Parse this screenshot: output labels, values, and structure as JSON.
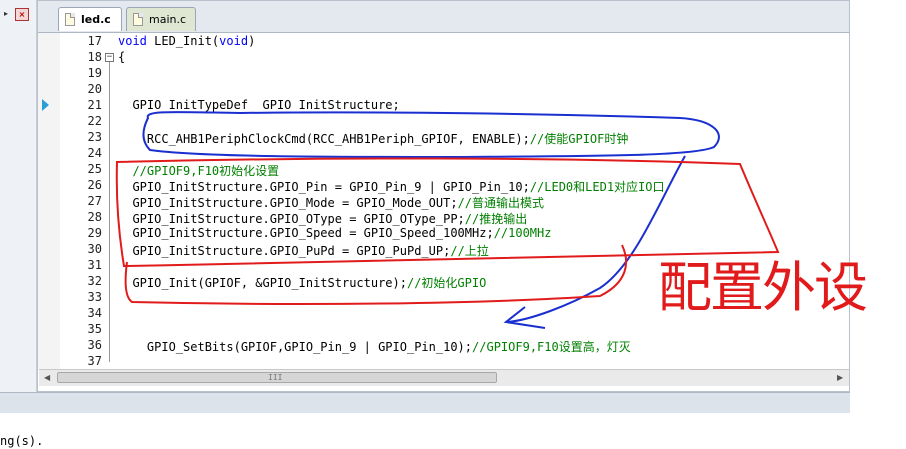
{
  "tabs": [
    {
      "label": "led.c",
      "active": true
    },
    {
      "label": "main.c",
      "active": false
    }
  ],
  "lines": [
    {
      "num": "17",
      "parts": [
        {
          "t": "void",
          "c": "kw"
        },
        {
          "t": " LED_Init(",
          "c": ""
        },
        {
          "t": "void",
          "c": "kw"
        },
        {
          "t": ")",
          "c": ""
        }
      ]
    },
    {
      "num": "18",
      "parts": [
        {
          "t": "{",
          "c": ""
        }
      ]
    },
    {
      "num": "19",
      "parts": []
    },
    {
      "num": "20",
      "parts": []
    },
    {
      "num": "21",
      "parts": [
        {
          "t": "  GPIO_InitTypeDef  GPIO_InitStructure;",
          "c": ""
        }
      ]
    },
    {
      "num": "22",
      "parts": []
    },
    {
      "num": "23",
      "parts": [
        {
          "t": "    RCC_AHB1PeriphClockCmd(RCC_AHB1Periph_GPIOF, ENABLE);",
          "c": ""
        },
        {
          "t": "//使能GPIOF时钟",
          "c": "cm"
        }
      ]
    },
    {
      "num": "24",
      "parts": []
    },
    {
      "num": "25",
      "parts": [
        {
          "t": "  //GPIOF9,F10初始化设置",
          "c": "cm"
        }
      ]
    },
    {
      "num": "26",
      "parts": [
        {
          "t": "  GPIO_InitStructure.GPIO_Pin = GPIO_Pin_9 | GPIO_Pin_10;",
          "c": ""
        },
        {
          "t": "//LED0和LED1对应IO口",
          "c": "cm"
        }
      ]
    },
    {
      "num": "27",
      "parts": [
        {
          "t": "  GPIO_InitStructure.GPIO_Mode = GPIO_Mode_OUT;",
          "c": ""
        },
        {
          "t": "//普通输出模式",
          "c": "cm"
        }
      ]
    },
    {
      "num": "28",
      "parts": [
        {
          "t": "  GPIO_InitStructure.GPIO_OType = GPIO_OType_PP;",
          "c": ""
        },
        {
          "t": "//推挽输出",
          "c": "cm"
        }
      ]
    },
    {
      "num": "29",
      "parts": [
        {
          "t": "  GPIO_InitStructure.GPIO_Speed = GPIO_Speed_100MHz;",
          "c": ""
        },
        {
          "t": "//100MHz",
          "c": "cm"
        }
      ]
    },
    {
      "num": "30",
      "parts": [
        {
          "t": "  GPIO_InitStructure.GPIO_PuPd = GPIO_PuPd_UP;",
          "c": ""
        },
        {
          "t": "//上拉",
          "c": "cm"
        }
      ]
    },
    {
      "num": "31",
      "parts": []
    },
    {
      "num": "32",
      "parts": [
        {
          "t": "  GPIO_Init(GPIOF, &GPIO_InitStructure);",
          "c": ""
        },
        {
          "t": "//初始化GPIO",
          "c": "cm"
        }
      ]
    },
    {
      "num": "33",
      "parts": []
    },
    {
      "num": "34",
      "parts": []
    },
    {
      "num": "35",
      "parts": []
    },
    {
      "num": "36",
      "parts": [
        {
          "t": "    GPIO_SetBits(GPIOF,GPIO_Pin_9 | GPIO_Pin_10);",
          "c": ""
        },
        {
          "t": "//GPIOF9,F10设置高，灯灭",
          "c": "cm"
        }
      ]
    },
    {
      "num": "37",
      "parts": []
    }
  ],
  "annotation_text": "配置外设",
  "scrollbar_grip": "III",
  "output_text": "ng(s).",
  "colors": {
    "keyword": "#0000ff",
    "comment": "#008000",
    "annotation_red": "#e11b1b",
    "annotation_blue": "#1a2fd0"
  }
}
